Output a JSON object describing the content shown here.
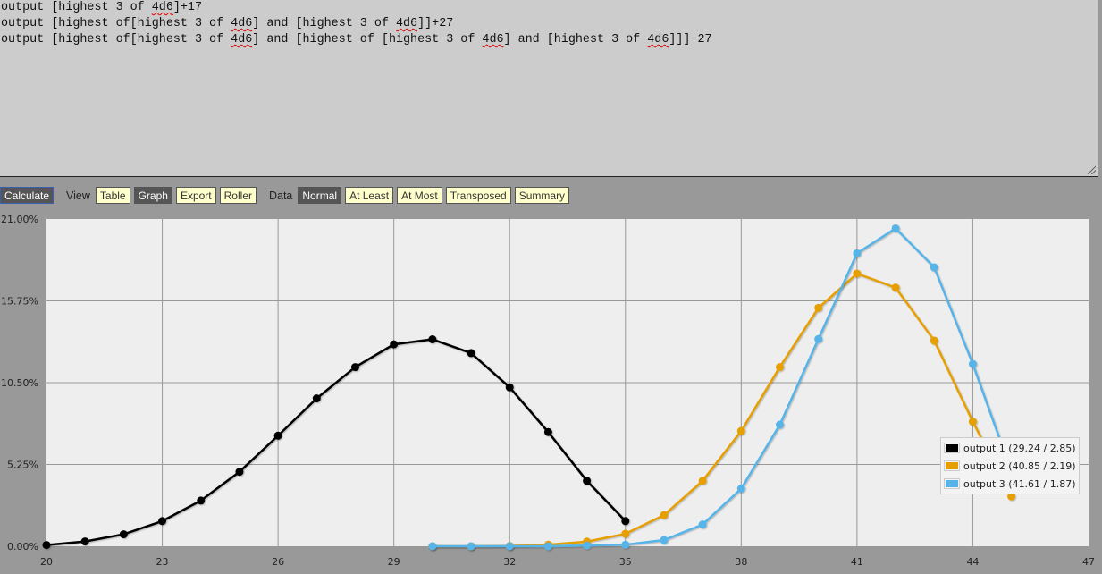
{
  "editor": {
    "lines": [
      [
        {
          "t": "output [highest 3 of "
        },
        {
          "t": "4d6",
          "spell": true
        },
        {
          "t": "]+17"
        }
      ],
      [
        {
          "t": "output [highest of[highest 3 of "
        },
        {
          "t": "4d6",
          "spell": true
        },
        {
          "t": "] and [highest 3 of "
        },
        {
          "t": "4d6",
          "spell": true
        },
        {
          "t": "]]+27"
        }
      ],
      [
        {
          "t": "output [highest of[highest 3 of "
        },
        {
          "t": "4d6",
          "spell": true
        },
        {
          "t": "] and [highest of [highest 3 of "
        },
        {
          "t": "4d6",
          "spell": true
        },
        {
          "t": "] and [highest 3 of "
        },
        {
          "t": "4d6",
          "spell": true
        },
        {
          "t": "]]]+27"
        }
      ]
    ]
  },
  "toolbar": {
    "calculate_label": "Calculate",
    "view_label": "View",
    "view_buttons": [
      {
        "label": "Table",
        "active": false
      },
      {
        "label": "Graph",
        "active": true
      },
      {
        "label": "Export",
        "active": false
      },
      {
        "label": "Roller",
        "active": false
      }
    ],
    "data_label": "Data",
    "data_buttons": [
      {
        "label": "Normal",
        "active": true
      },
      {
        "label": "At Least",
        "active": false
      },
      {
        "label": "At Most",
        "active": false
      },
      {
        "label": "Transposed",
        "active": false
      },
      {
        "label": "Summary",
        "active": false
      }
    ]
  },
  "chart_data": {
    "type": "line",
    "title": "",
    "xlabel": "",
    "ylabel": "",
    "xlim": [
      20,
      47
    ],
    "ylim": [
      0,
      21
    ],
    "x_ticks": [
      20,
      23,
      26,
      29,
      32,
      35,
      38,
      41,
      44,
      47
    ],
    "y_ticks": [
      0,
      5.25,
      10.5,
      15.75,
      21
    ],
    "y_tick_labels": [
      "0.00%",
      "5.25%",
      "10.50%",
      "15.75%",
      "21.00%"
    ],
    "grid": true,
    "legend_position": "top-right",
    "series": [
      {
        "name": "output 1 (29.24 / 2.85)",
        "color": "#000000",
        "x": [
          20,
          21,
          22,
          23,
          24,
          25,
          26,
          27,
          28,
          29,
          30,
          31,
          32,
          33,
          34,
          35
        ],
        "values": [
          0.08,
          0.31,
          0.77,
          1.62,
          2.93,
          4.78,
          7.1,
          9.49,
          11.5,
          12.96,
          13.28,
          12.4,
          10.2,
          7.33,
          4.2,
          1.62
        ]
      },
      {
        "name": "output 2 (40.85 / 2.19)",
        "color": "#e69f00",
        "x": [
          30,
          31,
          32,
          33,
          34,
          35,
          36,
          37,
          38,
          39,
          40,
          41,
          42,
          43,
          44,
          45
        ],
        "values": [
          0.0,
          0.0,
          0.02,
          0.1,
          0.3,
          0.8,
          2.0,
          4.2,
          7.4,
          11.5,
          15.3,
          17.5,
          16.6,
          13.2,
          8.0,
          3.2
        ]
      },
      {
        "name": "output 3 (41.61 / 1.87)",
        "color": "#56b4e9",
        "x": [
          30,
          31,
          32,
          33,
          34,
          35,
          36,
          37,
          38,
          39,
          40,
          41,
          42,
          43,
          44,
          45
        ],
        "values": [
          0.0,
          0.0,
          0.0,
          0.0,
          0.05,
          0.1,
          0.4,
          1.4,
          3.7,
          7.8,
          13.3,
          18.8,
          20.4,
          17.9,
          11.7,
          4.8
        ]
      }
    ]
  }
}
